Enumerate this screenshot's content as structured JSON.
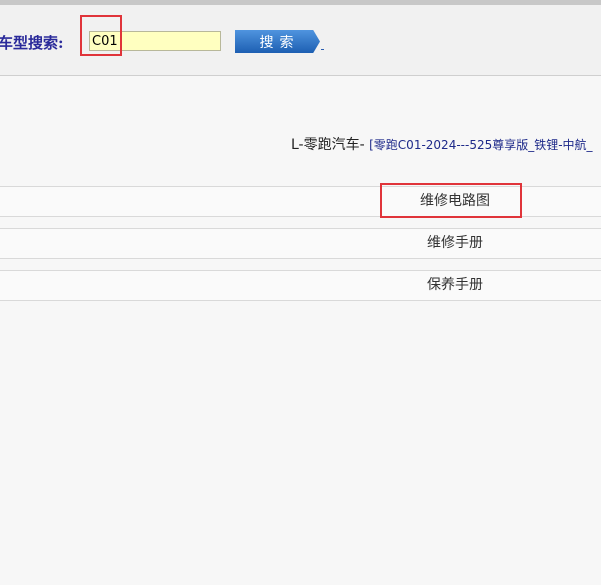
{
  "search": {
    "label": "车型搜索:",
    "value": "C01",
    "button_label": "搜索"
  },
  "result": {
    "brand": "L-零跑汽车-",
    "detail": "[零跑C01-2024---525尊享版_铁锂-中航_"
  },
  "menu": {
    "items": [
      {
        "label": "维修电路图"
      },
      {
        "label": "维修手册"
      },
      {
        "label": "保养手册"
      }
    ]
  },
  "colors": {
    "highlight": "#e0343a",
    "input_bg": "#ffffc0",
    "button_blue": "#1d5fb2",
    "label_blue": "#2a2a9a"
  }
}
